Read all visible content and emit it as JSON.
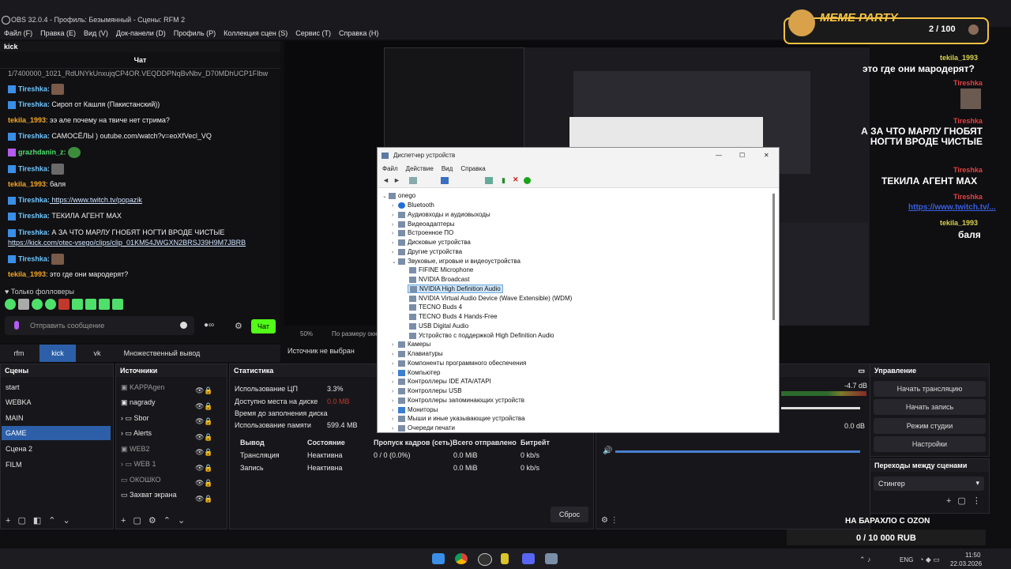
{
  "window_title": "OBS 32.0.4 - Профиль: Безымянный - Сцены: RFM 2",
  "menu": [
    "Файл (F)",
    "Правка (E)",
    "Вид (V)",
    "Док-панели (D)",
    "Профиль (P)",
    "Коллекция сцен (S)",
    "Сервис (T)",
    "Справка (H)"
  ],
  "chat": {
    "dock_title": "kick",
    "header": "Чат",
    "top_cut": "1/7400000_1021_RdUNYkUnxujqCP4OR.VEQDDPNqBvNbv_D70MDhUCP1FIbw",
    "messages": [
      {
        "user": "Tireshka:",
        "text": "",
        "color": "blue"
      },
      {
        "user": "Tireshka:",
        "text": " Сироп от Кашля (Пакистанский))",
        "color": "blue"
      },
      {
        "user": "tekila_1993",
        "text": ": ээ але почему на твиче нет стрима?",
        "color": "orange"
      },
      {
        "user": "Tireshka:",
        "text": " САМОСЁЛЫ ) outube.com/watch?v=eoXfVecl_VQ",
        "color": "blue"
      },
      {
        "user": "grazhdanin_z:",
        "text": "",
        "color": "green"
      },
      {
        "user": "Tireshka:",
        "text": "",
        "color": "blue"
      },
      {
        "user": "tekila_1993",
        "text": ": баля",
        "color": "orange"
      },
      {
        "user": "Tireshka:",
        "text": " https://www.twitch.tv/popazik",
        "color": "blue"
      },
      {
        "user": "Tireshka:",
        "text": " ТЕКИЛА АГЕНТ MAX",
        "color": "blue"
      },
      {
        "user": "Tireshka:",
        "text": " А ЗА ЧТО МАРЛУ ГНОБЯТ НОГТИ ВРОДЕ ЧИСТЫЕ",
        "color": "blue"
      },
      {
        "user": "",
        "text": "https://kick.com/otec-vsego/clips/clip_01KM54JWGXN2BRSJ39H9M7JBRB",
        "color": "link"
      },
      {
        "user": "Tireshka:",
        "text": "",
        "color": "blue"
      },
      {
        "user": "tekila_1993",
        "text": ": это где они мародерят?",
        "color": "orange"
      }
    ],
    "followers_only": "Только фолловеры",
    "input_placeholder": "Отправить сообщение",
    "send_label": "Чат"
  },
  "dock_tabs": [
    "rfm",
    "kick",
    "vk",
    "Множественный вывод"
  ],
  "preview": {
    "zoom": "50%",
    "fit": "По размеру окна",
    "source_hint": "Источник не выбран"
  },
  "scenes": {
    "title": "Сцены",
    "items": [
      "start",
      "WEBKA",
      "MAIN",
      "GAME",
      "Сцена 2",
      "FILM"
    ],
    "selected": "GAME"
  },
  "sources": {
    "title": "Источники",
    "items": [
      "KAPPAgen",
      "nagrady",
      "Sbor",
      "Alerts",
      "WEB2",
      "WEB 1",
      "ОКОШКО",
      "Захват экрана"
    ]
  },
  "stats": {
    "title": "Статистика",
    "cpu_label": "Использование ЦП",
    "cpu": "3.3%",
    "disk_label": "Доступно места на диске",
    "disk": "0.0 MB",
    "fill_label": "Время до заполнения диска",
    "mem_label": "Использование памяти",
    "mem": "599.4 MB",
    "cols": [
      "Вывод",
      "Состояние",
      "Пропуск кадров (сеть)",
      "Всего отправлено",
      "Битрейт"
    ],
    "rows": [
      [
        "Трансляция",
        "Неактивна",
        "0 / 0 (0.0%)",
        "0.0 MiB",
        "0 kb/s"
      ],
      [
        "Запись",
        "Неактивна",
        "",
        "0.0 MiB",
        "0 kb/s"
      ]
    ],
    "reset": "Сброс"
  },
  "audio": {
    "db1": "-4.7 dB",
    "db2": "0.0 dB",
    "ticks": [
      "-15",
      "-10",
      "-5",
      "0"
    ]
  },
  "controls": {
    "title": "Управление",
    "buttons": [
      "Начать трансляцию",
      "Начать запись",
      "Режим студии",
      "Настройки"
    ]
  },
  "transitions": {
    "title": "Переходы между сценами",
    "value": "Стингер"
  },
  "devmgr": {
    "title": "Диспетчер устройств",
    "menu": [
      "Файл",
      "Действие",
      "Вид",
      "Справка"
    ],
    "root": "onego",
    "categories_top": [
      "Bluetooth",
      "Аудиовходы и аудиовыходы",
      "Видеоадаптеры",
      "Встроенное ПО",
      "Дисковые устройства",
      "Другие устройства"
    ],
    "expanded": "Звуковые, игровые и видеоустройства",
    "children": [
      "FIFINE Microphone",
      "NVIDIA Broadcast",
      "NVIDIA High Definition Audio",
      "NVIDIA Virtual Audio Device (Wave Extensible) (WDM)",
      "TECNO Buds 4",
      "TECNO Buds 4 Hands-Free",
      "USB Digital Audio",
      "Устройство с поддержкой High Definition Audio"
    ],
    "selected_child": "NVIDIA High Definition Audio",
    "categories_bottom": [
      "Камеры",
      "Клавиатуры",
      "Компоненты программного обеспечения",
      "Компьютер",
      "Контроллеры IDE ATA/ATAPI",
      "Контроллеры USB",
      "Контроллеры запоминающих устройств",
      "Мониторы",
      "Мыши и иные указывающие устройства",
      "Очереди печати"
    ]
  },
  "overlay": {
    "party_title": "MEME PARTY",
    "party_count": "2 / 100",
    "chat": [
      {
        "name": "tekila_1993",
        "text": "это где они мародерят?"
      },
      {
        "name": "Tireshka",
        "text": ""
      },
      {
        "name": "Tireshka",
        "text": "А ЗА ЧТО МАРЛУ ГНОБЯТ НОГТИ ВРОДЕ ЧИСТЫЕ"
      },
      {
        "name": "Tireshka",
        "text": "ТЕКИЛА АГЕНТ MAX"
      },
      {
        "name": "Tireshka",
        "text": "https://www.twitch.tv/..."
      },
      {
        "name": "tekila_1993",
        "text": "баля"
      }
    ],
    "goal_title": "НА БАРАХЛО С OZON",
    "goal_value": "0 / 10 000 RUB"
  },
  "taskbar": {
    "lang": "ENG",
    "time": "11:50",
    "date": "22.03.2026"
  }
}
